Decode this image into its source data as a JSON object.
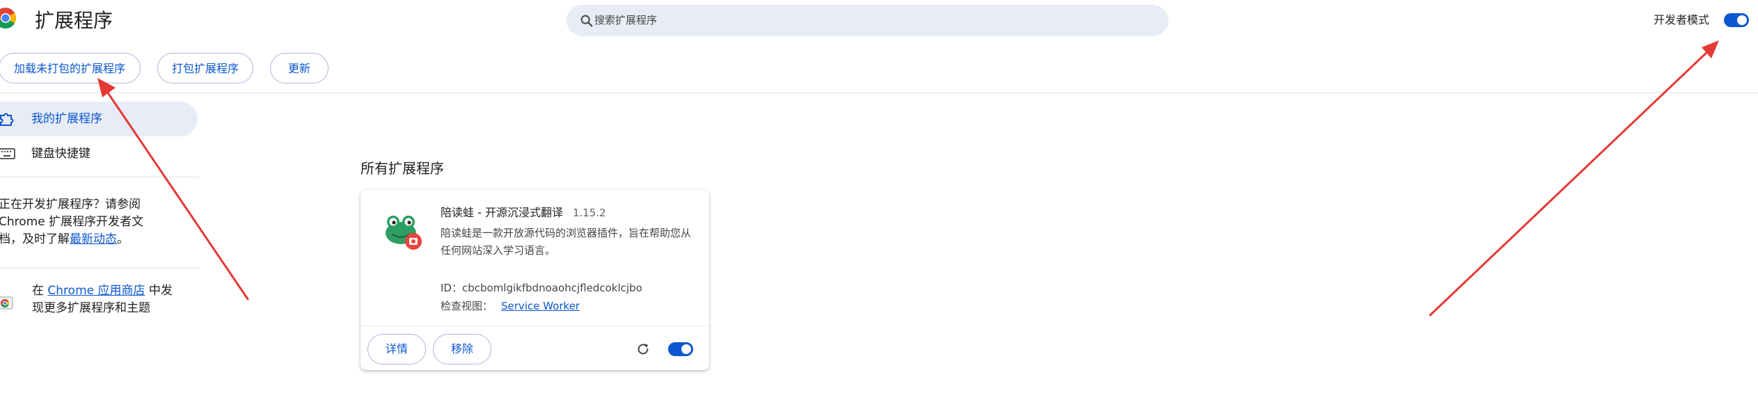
{
  "header": {
    "title": "扩展程序",
    "search_placeholder": "搜索扩展程序",
    "developer_mode_label": "开发者模式",
    "developer_mode_on": true
  },
  "toolbar": {
    "load_unpacked": "加载未打包的扩展程序",
    "pack_extension": "打包扩展程序",
    "update": "更新"
  },
  "sidebar": {
    "items": [
      {
        "label": "我的扩展程序",
        "icon": "puzzle-icon",
        "active": true
      },
      {
        "label": "键盘快捷键",
        "icon": "keyboard-icon",
        "active": false
      }
    ],
    "dev_note_prefix": "正在开发扩展程序？请参阅 Chrome 扩展程序开发者文档，及时了解",
    "dev_note_link": "最新动态",
    "dev_note_suffix": "。",
    "store_prefix": "在 ",
    "store_link": "Chrome 应用商店",
    "store_suffix": " 中发现更多扩展程序和主题"
  },
  "main": {
    "section_title": "所有扩展程序",
    "extension": {
      "name": "陪读蛙 - 开源沉浸式翻译",
      "version": "1.15.2",
      "description": "陪读蛙是一款开放源代码的浏览器插件，旨在帮助您从任何网站深入学习语言。",
      "id_label": "ID：",
      "id_value": "cbcbomlgikfbdnoaohcjfledcoklcjbo",
      "inspect_label": "检查视图：",
      "inspect_link": "Service Worker",
      "details_button": "详情",
      "remove_button": "移除",
      "enabled": true
    }
  },
  "colors": {
    "accent": "#0b57d0",
    "annotation_arrow": "#e53935"
  }
}
